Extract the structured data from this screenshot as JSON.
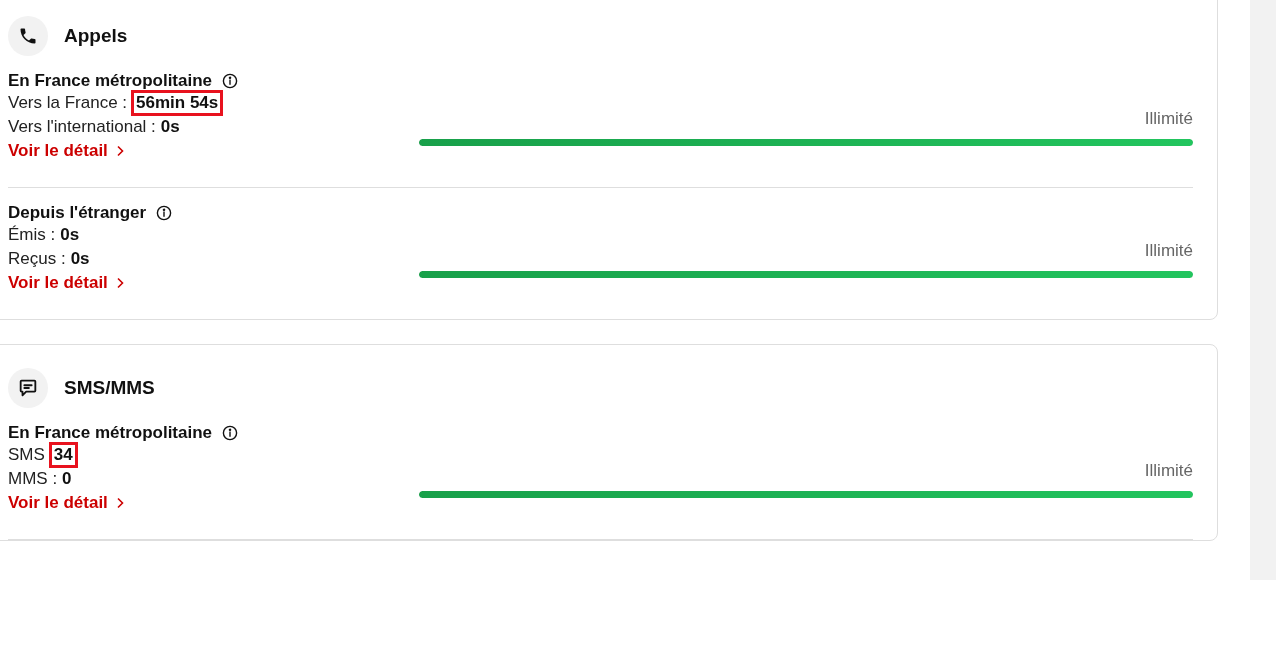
{
  "sections": [
    {
      "kind": "calls",
      "title": "Appels",
      "rows": [
        {
          "title": "En France métropolitaine",
          "lines": [
            {
              "label": "Vers la France :",
              "value": "56min 54s",
              "highlighted": true
            },
            {
              "label": "Vers l'international :",
              "value": "0s",
              "highlighted": false
            }
          ],
          "link": "Voir le détail",
          "limit": "Illimité",
          "level": 1,
          "separator": true
        },
        {
          "title": "Depuis l'étranger",
          "lines": [
            {
              "label": "Émis :",
              "value": "0s",
              "highlighted": false
            },
            {
              "label": "Reçus :",
              "value": "0s",
              "highlighted": false
            }
          ],
          "link": "Voir le détail",
          "limit": "Illimité",
          "level": 1,
          "separator": false
        }
      ]
    },
    {
      "kind": "messages",
      "title": "SMS/MMS",
      "rows": [
        {
          "title": "En France métropolitaine",
          "lines": [
            {
              "label": "SMS",
              "value": "34",
              "highlighted": true
            },
            {
              "label": "MMS :",
              "value": "0",
              "highlighted": false
            }
          ],
          "link": "Voir le détail",
          "limit": "Illimité",
          "level": 1,
          "separator": true
        }
      ]
    }
  ]
}
